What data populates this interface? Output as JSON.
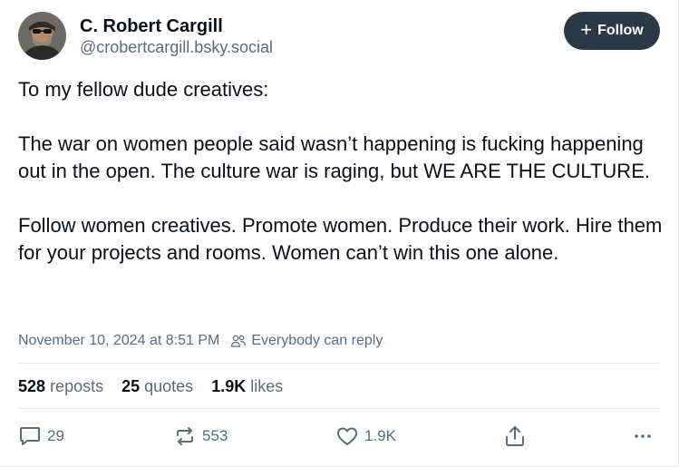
{
  "author": {
    "name": "C. Robert Cargill",
    "handle": "@crobertcargill.bsky.social"
  },
  "follow_button": {
    "label": "Follow",
    "icon": "plus-icon"
  },
  "post": {
    "paragraph_1": "To my fellow dude creatives:",
    "paragraph_2": "The war on women people said wasn’t happening is fucking happening out in the open. The culture war is raging, but WE ARE THE CULTURE.",
    "paragraph_3": "Follow women creatives. Promote women. Produce their work. Hire them for your projects and rooms. Women can’t win this one alone."
  },
  "meta": {
    "timestamp": "November 10, 2024 at 8:51 PM",
    "reply_setting": "Everybody can reply"
  },
  "stats": {
    "reposts": {
      "count": "528",
      "label": "reposts"
    },
    "quotes": {
      "count": "25",
      "label": "quotes"
    },
    "likes": {
      "count": "1.9K",
      "label": "likes"
    }
  },
  "actions": {
    "reply": {
      "icon": "reply-bubble-icon",
      "count": "29"
    },
    "repost": {
      "icon": "repost-icon",
      "count": "553"
    },
    "like": {
      "icon": "heart-icon",
      "count": "1.9K"
    },
    "share": {
      "icon": "share-icon"
    },
    "more": {
      "icon": "more-dots-icon"
    }
  },
  "colors": {
    "follow_button_bg": "#2b3947",
    "muted_text": "#5b6b7b",
    "primary_text": "#0b0f14"
  }
}
